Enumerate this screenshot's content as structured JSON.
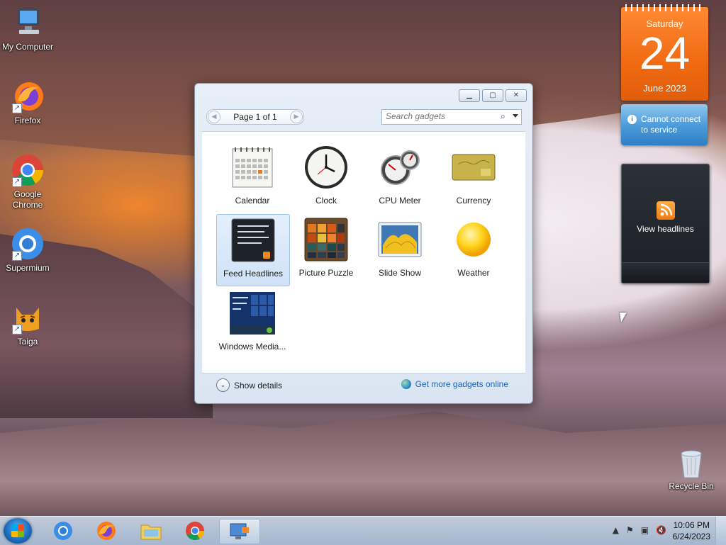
{
  "desktop": {
    "icons": [
      {
        "label": "My Computer",
        "icon": "computer-icon"
      },
      {
        "label": "Firefox",
        "icon": "firefox-icon"
      },
      {
        "label": "Google Chrome",
        "icon": "chrome-icon"
      },
      {
        "label": "Supermium",
        "icon": "supermium-icon"
      },
      {
        "label": "Taiga",
        "icon": "taiga-icon"
      },
      {
        "label": "Recycle Bin",
        "icon": "recycle-bin-icon"
      }
    ]
  },
  "gadgets_right": {
    "calendar": {
      "day": "Saturday",
      "date": "24",
      "month": "June 2023"
    },
    "weather": {
      "message": "Cannot connect to service",
      "info_glyph": "i"
    },
    "feed": {
      "label": "View headlines"
    }
  },
  "gadget_window": {
    "pager": {
      "label": "Page 1 of 1",
      "prev_glyph": "◀",
      "next_glyph": "▶"
    },
    "search": {
      "placeholder": "Search gadgets",
      "icon": "magnifier-icon"
    },
    "controls": {
      "minimize": "▁",
      "restore": "▢",
      "close": "✕"
    },
    "gadgets": [
      {
        "name": "Calendar",
        "selected": false
      },
      {
        "name": "Clock",
        "selected": false
      },
      {
        "name": "CPU Meter",
        "selected": false
      },
      {
        "name": "Currency",
        "selected": false
      },
      {
        "name": "Feed Headlines",
        "selected": true
      },
      {
        "name": "Picture Puzzle",
        "selected": false
      },
      {
        "name": "Slide Show",
        "selected": false
      },
      {
        "name": "Weather",
        "selected": false
      },
      {
        "name": "Windows Media...",
        "selected": false
      }
    ],
    "footer": {
      "show_details": "Show details",
      "more_online": "Get more gadgets online",
      "chevron_glyph": "⌄"
    }
  },
  "taskbar": {
    "pinned": [
      "Supermium",
      "Firefox",
      "Windows Explorer",
      "Google Chrome",
      "Desktop Gadget Gallery"
    ],
    "clock": {
      "time": "10:06 PM",
      "date": "6/24/2023"
    },
    "tray_glyphs": [
      "▲",
      "⚑",
      "▣",
      "🔇"
    ]
  },
  "colors": {
    "accent": "#1565c0",
    "calendar_orange": "#f06a12",
    "window_bg": "#e6eef7"
  }
}
